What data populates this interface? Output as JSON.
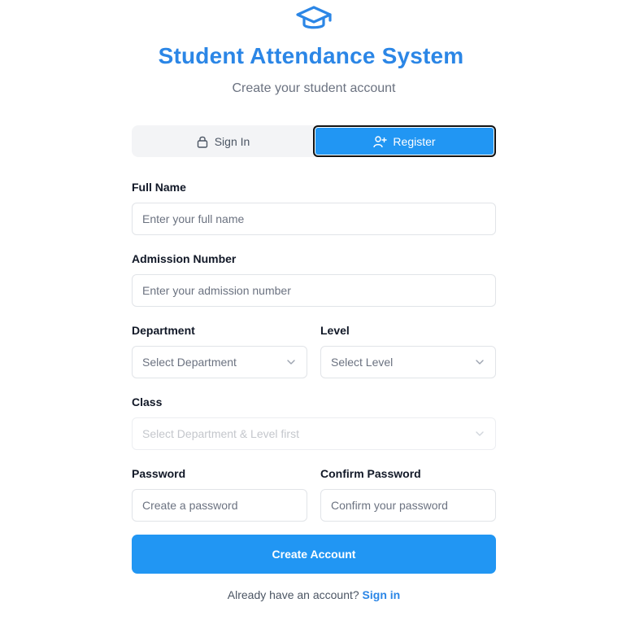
{
  "header": {
    "logo_icon": "graduation-cap-icon",
    "title": "Student Attendance System",
    "subtitle": "Create your student account"
  },
  "tabs": [
    {
      "label": "Sign In",
      "icon": "lock-icon",
      "active": false
    },
    {
      "label": "Register",
      "icon": "user-plus-icon",
      "active": true
    }
  ],
  "form": {
    "full_name": {
      "label": "Full Name",
      "placeholder": "Enter your full name",
      "value": ""
    },
    "admission_number": {
      "label": "Admission Number",
      "placeholder": "Enter your admission number",
      "value": ""
    },
    "department": {
      "label": "Department",
      "selected": "Select Department"
    },
    "level": {
      "label": "Level",
      "selected": "Select Level"
    },
    "class": {
      "label": "Class",
      "selected": "Select Department & Level first",
      "disabled": true
    },
    "password": {
      "label": "Password",
      "placeholder": "Create a password",
      "value": ""
    },
    "confirm_password": {
      "label": "Confirm Password",
      "placeholder": "Confirm your password",
      "value": ""
    },
    "submit_label": "Create Account"
  },
  "footer": {
    "prompt": "Already have an account?",
    "link": "Sign in"
  },
  "colors": {
    "primary": "#2196f3",
    "title": "#2b86e6"
  }
}
